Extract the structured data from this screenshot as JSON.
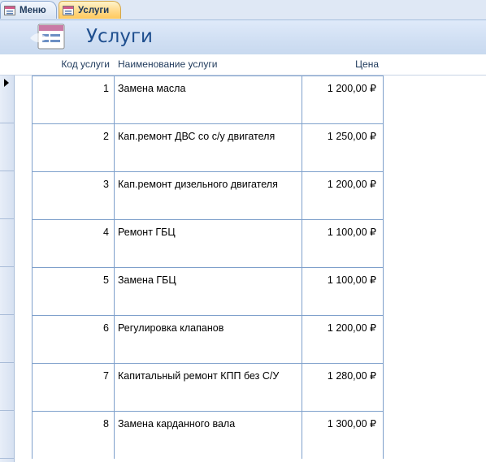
{
  "tabs": [
    {
      "label": "Меню",
      "active": false
    },
    {
      "label": "Услуги",
      "active": true
    }
  ],
  "header": {
    "title": "Услуги"
  },
  "columns": {
    "code": "Код услуги",
    "name": "Наименование услуги",
    "price": "Цена"
  },
  "rows": [
    {
      "code": "1",
      "name": "Замена масла",
      "price": "1 200,00 ₽"
    },
    {
      "code": "2",
      "name": "Кап.ремонт ДВС со с/у двигателя",
      "price": "1 250,00 ₽"
    },
    {
      "code": "3",
      "name": "Кап.ремонт  дизельного двигателя",
      "price": "1 200,00 ₽"
    },
    {
      "code": "4",
      "name": "Ремонт ГБЦ",
      "price": "1 100,00 ₽"
    },
    {
      "code": "5",
      "name": "Замена ГБЦ",
      "price": "1 100,00 ₽"
    },
    {
      "code": "6",
      "name": "Регулировка клапанов",
      "price": "1 200,00 ₽"
    },
    {
      "code": "7",
      "name": "Капитальный ремонт КПП без С/У",
      "price": "1 280,00 ₽"
    },
    {
      "code": "8",
      "name": "Замена карданного вала",
      "price": "1 300,00 ₽"
    }
  ],
  "current_record_index": 0
}
